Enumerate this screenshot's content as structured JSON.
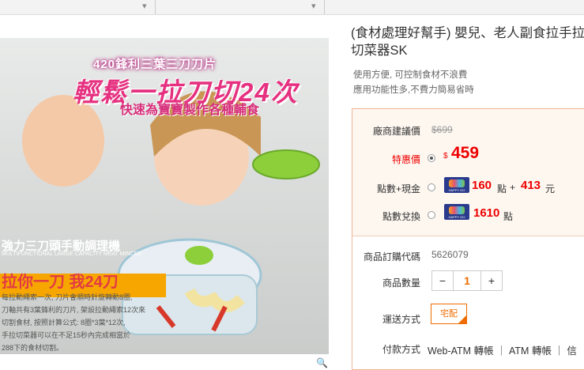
{
  "product": {
    "title": "(食材處理好幫手) 嬰兒、老人副食拉手拉切菜器SK",
    "desc_lines": [
      "使用方便, 可控制食材不浪費",
      "應用功能性多,不費力簡易省時"
    ]
  },
  "image": {
    "headline": "420鋒利三葉三刀刀片",
    "slogan": "輕鬆一拉刀切24次",
    "sub": "快速為寶寶製作各種輔食",
    "banner_main": "強力三刀頭手動調理機",
    "banner_en": "MULTIFUNCTIONAL LARGE CAPACITY MEAT MINCER",
    "big_text": "拉你一刀 我24刀",
    "desc_lines": [
      "每拉動繩索一次, 刀片會順時針旋轉動8圈,",
      "刀軸共有3葉鋒利的刀片, 架設拉動繩索12次來",
      "切割食材, 按照計算公式: 8圈*3葉*12次,",
      "手拉切菜器可以在不足15秒內完成相當於",
      "288下的食材切割。"
    ]
  },
  "pricing": {
    "original_label": "廠商建議價",
    "original_price": "$699",
    "special_label": "特惠價",
    "currency": "$",
    "special_price": "459",
    "points_cash_label": "點數+現金",
    "points_cash_points": "160",
    "points_unit": "點",
    "plus": "+",
    "points_cash_money": "413",
    "money_unit": "元",
    "points_redeem_label": "點數兌換",
    "points_redeem_points": "1610",
    "happygo": "HAPPY GO"
  },
  "order": {
    "code_label": "商品訂購代碼",
    "code": "5626079",
    "qty_label": "商品數量",
    "minus": "−",
    "qty": "1",
    "plus": "+",
    "ship_label": "運送方式",
    "ship_option": "宅配",
    "ship_check": "✓",
    "pay_label": "付款方式",
    "pay_options": "Web-ATM 轉帳 ｜ ATM 轉帳 ｜ 信"
  },
  "zoom_icon": "magnifier-icon",
  "colors": {
    "accent": "#ee6c00",
    "price": "#e00000",
    "panel_border": "#f1b596"
  }
}
